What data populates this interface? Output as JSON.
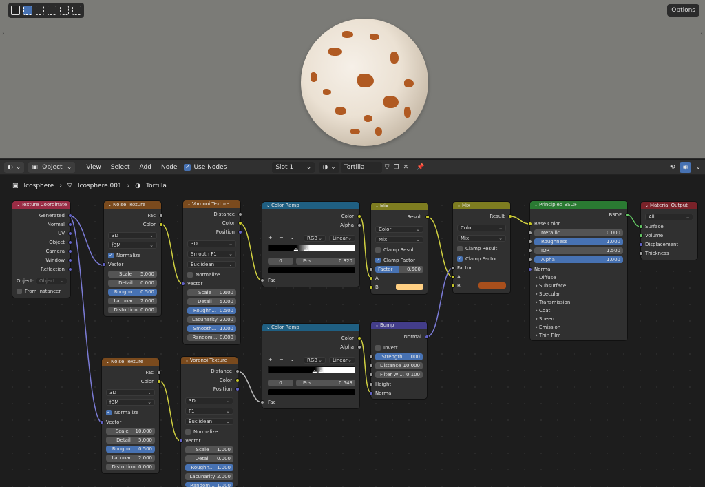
{
  "viewport": {
    "options_label": "Options"
  },
  "header": {
    "object_mode": "Object",
    "menus": [
      "View",
      "Select",
      "Add",
      "Node"
    ],
    "use_nodes_label": "Use Nodes",
    "slot": "Slot 1",
    "material_name": "Tortilla"
  },
  "breadcrumb": {
    "object": "Icosphere",
    "mesh": "Icosphere.001",
    "material": "Tortilla"
  },
  "nodes": {
    "texcoord": {
      "title": "Texture Coordinate",
      "outputs": [
        "Generated",
        "Normal",
        "UV",
        "Object",
        "Camera",
        "Window",
        "Reflection"
      ],
      "object_label": "Object:",
      "object_placeholder": "Object",
      "from_instancer": "From Instancer"
    },
    "noise1": {
      "title": "Noise Texture",
      "fac": "Fac",
      "color": "Color",
      "dim": "3D",
      "type": "fBM",
      "normalize": "Normalize",
      "vector": "Vector",
      "fields": [
        [
          "Scale",
          "5.000"
        ],
        [
          "Detail",
          "0.000"
        ],
        [
          "Roughn...",
          "0.500"
        ],
        [
          "Lacunar...",
          "2.000"
        ],
        [
          "Distortion",
          "0.000"
        ]
      ]
    },
    "voronoi1": {
      "title": "Voronoi Texture",
      "outs": [
        "Distance",
        "Color",
        "Position"
      ],
      "dim": "3D",
      "feature": "Smooth F1",
      "metric": "Euclidean",
      "normalize": "Normalize",
      "vector": "Vector",
      "fields": [
        [
          "Scale",
          "0.600"
        ],
        [
          "Detail",
          "5.000"
        ],
        [
          "Roughn...",
          "0.500"
        ],
        [
          "Lacunarity",
          "2.000"
        ],
        [
          "Smooth...",
          "1.000"
        ],
        [
          "Random...",
          "0.000"
        ]
      ]
    },
    "ramp1": {
      "title": "Color Ramp",
      "color": "Color",
      "alpha": "Alpha",
      "mode": "RGB",
      "interp": "Linear",
      "index": "0",
      "pos_label": "Pos",
      "pos": "0.320",
      "fac": "Fac"
    },
    "ramp2": {
      "title": "Color Ramp",
      "color": "Color",
      "alpha": "Alpha",
      "mode": "RGB",
      "interp": "Linear",
      "index": "0",
      "pos_label": "Pos",
      "pos": "0.543",
      "fac": "Fac"
    },
    "mix1": {
      "title": "Mix",
      "result": "Result",
      "dtype": "Color",
      "blend": "Mix",
      "clamp_result": "Clamp Result",
      "clamp_factor": "Clamp Factor",
      "factor_label": "Factor",
      "factor": "0.500",
      "a": "A",
      "b": "B",
      "b_color": "#ffcf82"
    },
    "mix2": {
      "title": "Mix",
      "result": "Result",
      "dtype": "Color",
      "blend": "Mix",
      "clamp_result": "Clamp Result",
      "clamp_factor": "Clamp Factor",
      "factor_label": "Factor",
      "a": "A",
      "b": "B",
      "b_color": "#a84f1c"
    },
    "bump": {
      "title": "Bump",
      "normal_out": "Normal",
      "invert": "Invert",
      "fields": [
        [
          "Strength",
          "1.000"
        ],
        [
          "Distance",
          "10.000"
        ],
        [
          "Filter Wi...",
          "0.100"
        ]
      ],
      "height": "Height",
      "normal_in": "Normal"
    },
    "bsdf": {
      "title": "Principled BSDF",
      "bsdf": "BSDF",
      "base_color": "Base Color",
      "fields": [
        [
          "Metallic",
          "0.000"
        ],
        [
          "Roughness",
          "1.000"
        ],
        [
          "IOR",
          "1.500"
        ],
        [
          "Alpha",
          "1.000"
        ]
      ],
      "normal": "Normal",
      "panels": [
        "Diffuse",
        "Subsurface",
        "Specular",
        "Transmission",
        "Coat",
        "Sheen",
        "Emission",
        "Thin Film"
      ]
    },
    "output": {
      "title": "Material Output",
      "target": "All",
      "inputs": [
        "Surface",
        "Volume",
        "Displacement",
        "Thickness"
      ]
    },
    "noise2": {
      "title": "Noise Texture",
      "fac": "Fac",
      "color": "Color",
      "dim": "3D",
      "type": "fBM",
      "normalize": "Normalize",
      "vector": "Vector",
      "fields": [
        [
          "Scale",
          "10.000"
        ],
        [
          "Detail",
          "5.000"
        ],
        [
          "Roughn...",
          "0.500"
        ],
        [
          "Lacunar...",
          "2.000"
        ],
        [
          "Distortion",
          "0.000"
        ]
      ]
    },
    "voronoi2": {
      "title": "Voronoi Texture",
      "outs": [
        "Distance",
        "Color",
        "Position"
      ],
      "dim": "3D",
      "feature": "F1",
      "metric": "Euclidean",
      "normalize": "Normalize",
      "vector": "Vector",
      "fields": [
        [
          "Scale",
          "1.000"
        ],
        [
          "Detail",
          "0.000"
        ],
        [
          "Roughn...",
          "1.000"
        ],
        [
          "Lacunarity",
          "2.000"
        ],
        [
          "Random...",
          "1.000"
        ]
      ]
    }
  }
}
